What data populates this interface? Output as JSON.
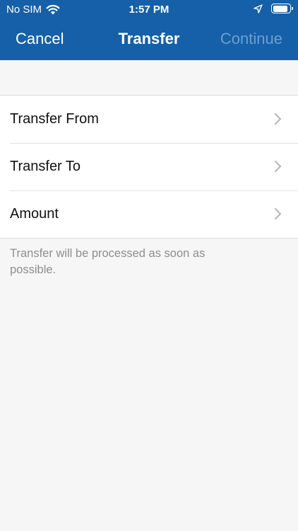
{
  "status_bar": {
    "carrier": "No SIM",
    "time": "1:57 PM",
    "battery_percent": 80
  },
  "nav": {
    "cancel_label": "Cancel",
    "title": "Transfer",
    "continue_label": "Continue"
  },
  "rows": [
    {
      "label": "Transfer From"
    },
    {
      "label": "Transfer To"
    },
    {
      "label": "Amount"
    }
  ],
  "footnote": "Transfer will be processed as soon as possible.",
  "colors": {
    "header": "#1560a8",
    "continue_disabled": "#6e9ed0",
    "background": "#f6f6f6"
  }
}
